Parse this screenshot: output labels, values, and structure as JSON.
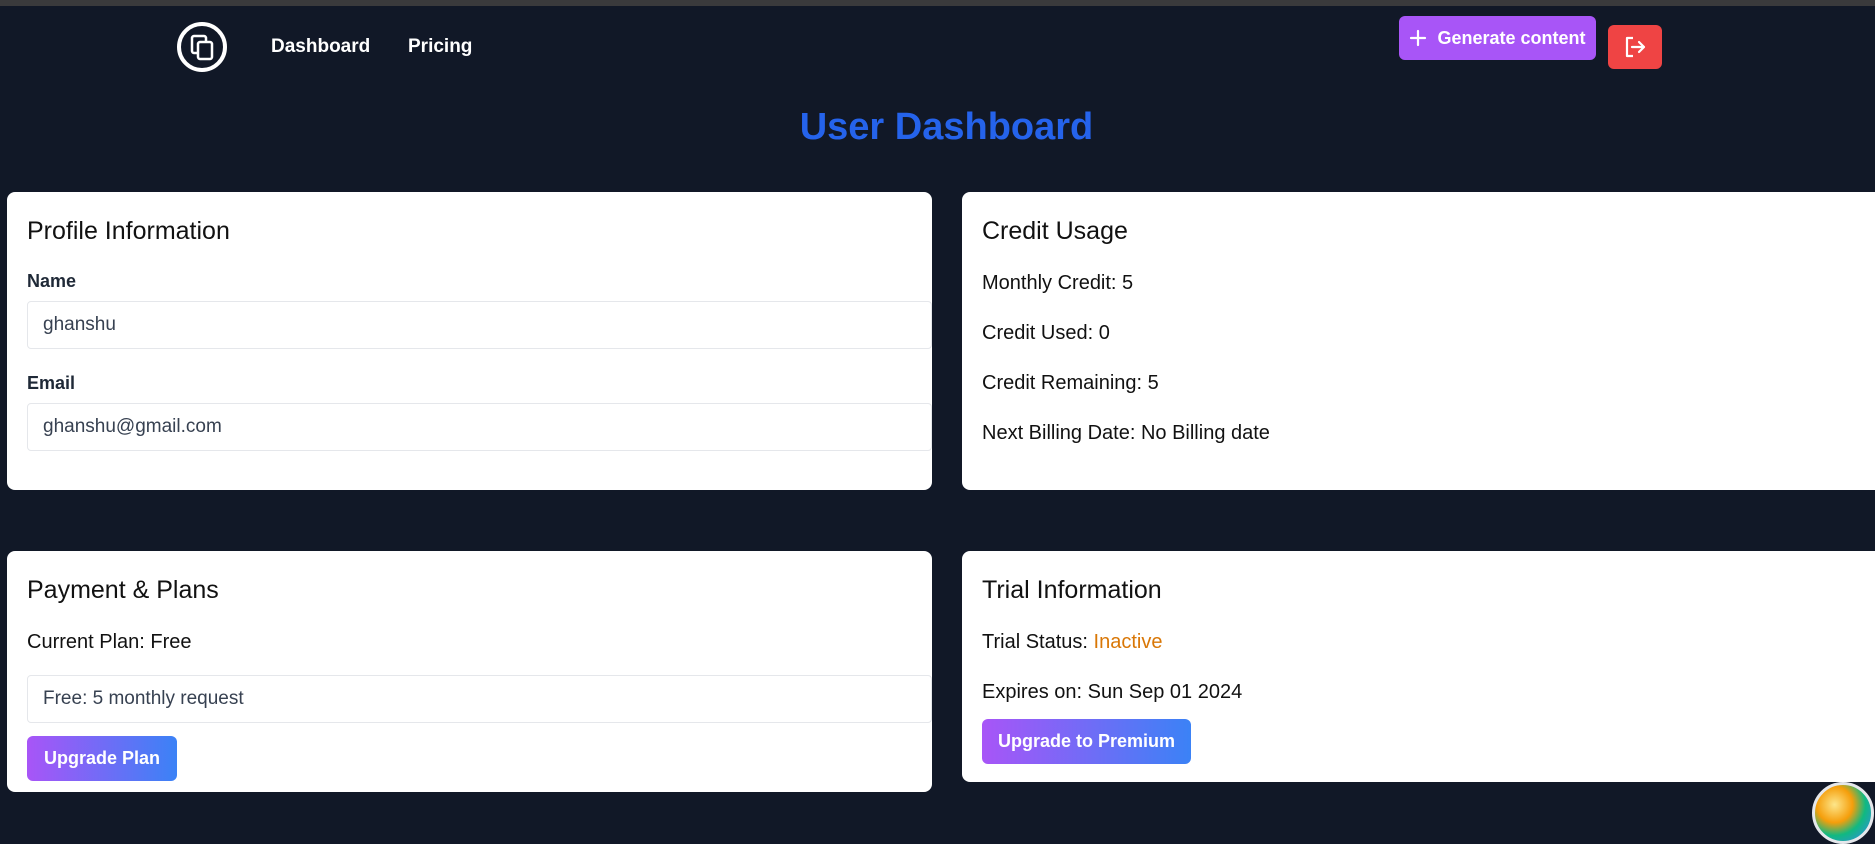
{
  "nav": {
    "logo_icon": "copy-icon",
    "links": [
      {
        "label": "Dashboard"
      },
      {
        "label": "Pricing"
      }
    ],
    "generate_label": "Generate content",
    "generate_icon": "plus-icon",
    "logout_icon": "logout-icon"
  },
  "page": {
    "title": "User Dashboard"
  },
  "profile": {
    "heading": "Profile Information",
    "name_label": "Name",
    "name_value": "ghanshu",
    "email_label": "Email",
    "email_value": "ghanshu@gmail.com"
  },
  "credit": {
    "heading": "Credit Usage",
    "monthly": "Monthly Credit: 5",
    "used": "Credit Used: 0",
    "remaining": "Credit Remaining: 5",
    "billing": "Next Billing Date: No Billing date"
  },
  "payment": {
    "heading": "Payment & Plans",
    "current_plan": "Current Plan: Free",
    "plan_value": "Free: 5 monthly request",
    "upgrade_label": "Upgrade Plan"
  },
  "trial": {
    "heading": "Trial Information",
    "status_label": "Trial Status: ",
    "status_value": "Inactive",
    "expires": "Expires on: Sun Sep 01 2024",
    "upgrade_label": "Upgrade to Premium"
  },
  "colors": {
    "background": "#111827",
    "title_blue": "#2563eb",
    "generate_purple": "#a855f7",
    "logout_red": "#ef4444",
    "inactive_orange": "#d97706"
  }
}
